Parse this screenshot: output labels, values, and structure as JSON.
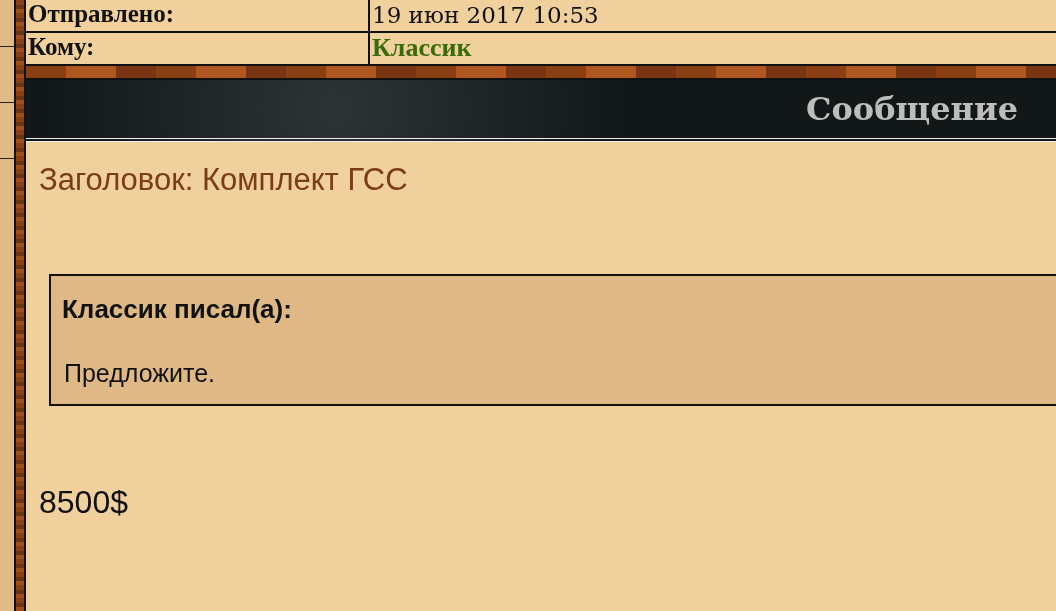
{
  "header": {
    "rows": [
      {
        "label": "Отправлено:",
        "value": "19 июн 2017 10:53",
        "kind": "text"
      },
      {
        "label": "Кому:",
        "value": "Классик",
        "kind": "user"
      }
    ]
  },
  "section_title": "Сообщение",
  "post": {
    "subject": "Заголовок: Комплект ГСС",
    "quote": {
      "author": "Классик писал(а):",
      "text": "Предложите."
    },
    "body": "8500$"
  }
}
